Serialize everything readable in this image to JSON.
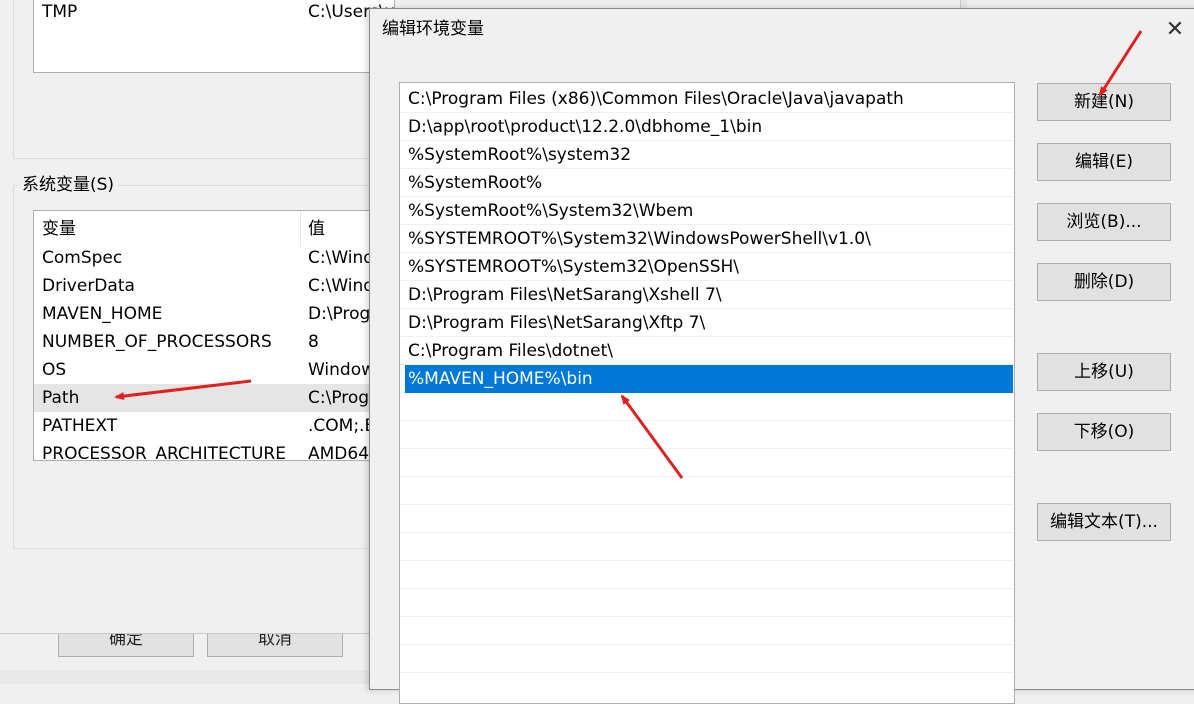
{
  "background_dialog": {
    "user_vars": [
      {
        "name": "TMP",
        "value": "C:\\Users\\xx\\AppData\\Local\\Temp"
      }
    ],
    "system_vars_group_label": "系统变量(S)",
    "system_vars_headers": {
      "name": "变量",
      "value": "值"
    },
    "system_vars": [
      {
        "name": "ComSpec",
        "value": "C:\\Wind"
      },
      {
        "name": "DriverData",
        "value": "C:\\Wind"
      },
      {
        "name": "MAVEN_HOME",
        "value": "D:\\Prog"
      },
      {
        "name": "NUMBER_OF_PROCESSORS",
        "value": "8"
      },
      {
        "name": "OS",
        "value": "Window"
      },
      {
        "name": "Path",
        "value": "C:\\Prog"
      },
      {
        "name": "PATHEXT",
        "value": ".COM;.E"
      },
      {
        "name": "PROCESSOR_ARCHITECTURE",
        "value": "AMD64"
      }
    ],
    "buttons": {
      "ok": "确定",
      "cancel": "取消"
    }
  },
  "edit_dialog": {
    "title": "编辑环境变量",
    "close_glyph": "✕",
    "paths": [
      "C:\\Program Files (x86)\\Common Files\\Oracle\\Java\\javapath",
      "D:\\app\\root\\product\\12.2.0\\dbhome_1\\bin",
      "%SystemRoot%\\system32",
      "%SystemRoot%",
      "%SystemRoot%\\System32\\Wbem",
      "%SYSTEMROOT%\\System32\\WindowsPowerShell\\v1.0\\",
      "%SYSTEMROOT%\\System32\\OpenSSH\\",
      "D:\\Program Files\\NetSarang\\Xshell 7\\",
      "D:\\Program Files\\NetSarang\\Xftp 7\\",
      "C:\\Program Files\\dotnet\\",
      "%MAVEN_HOME%\\bin"
    ],
    "selected_index": 10,
    "buttons": {
      "new": "新建(N)",
      "edit": "编辑(E)",
      "browse": "浏览(B)...",
      "delete": "删除(D)",
      "move_up": "上移(U)",
      "move_down": "下移(O)",
      "edit_text": "编辑文本(T)..."
    }
  },
  "colors": {
    "selection": "#0078d7",
    "annotation_arrow": "#e02020"
  }
}
